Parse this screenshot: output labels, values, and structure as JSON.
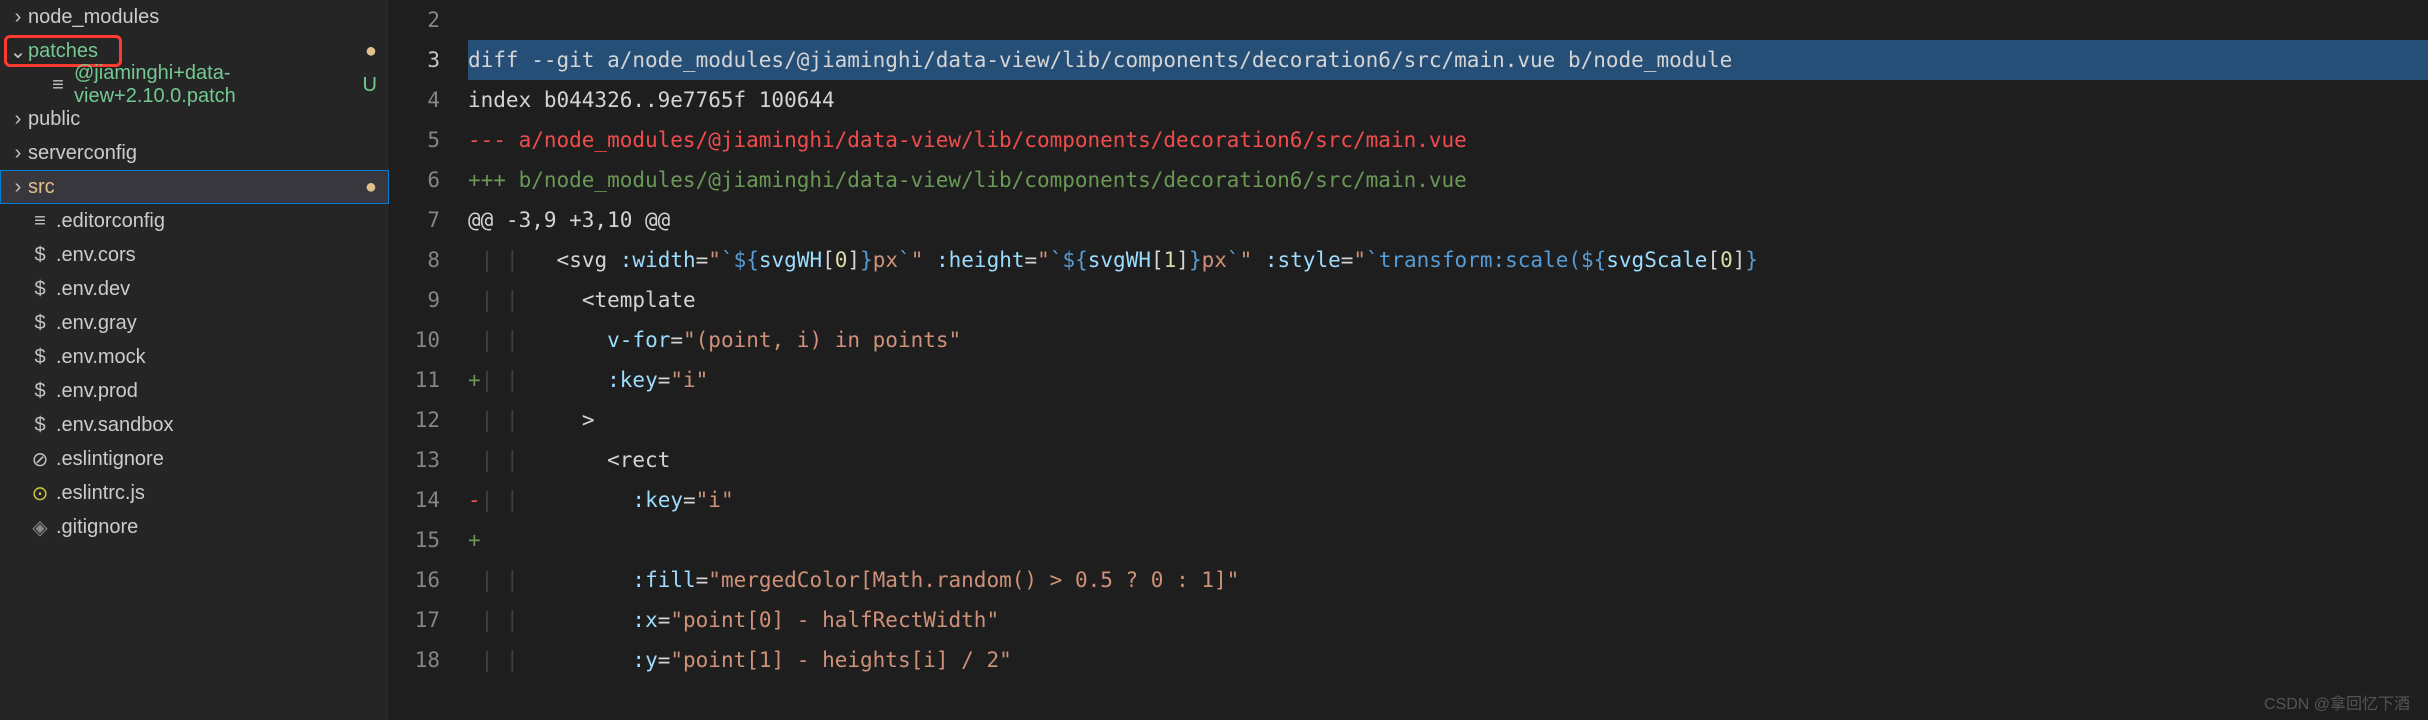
{
  "sidebar": {
    "items": [
      {
        "chevron": "›",
        "icon": "",
        "label": "node_modules",
        "status": "",
        "classes": ""
      },
      {
        "chevron": "⌄",
        "icon": "",
        "label": "patches",
        "status": "●",
        "classes": "added",
        "statusClass": "dot-mod",
        "highlight": true
      },
      {
        "chevron": "",
        "icon": "≡",
        "label": "@jiaminghi+data-view+2.10.0.patch",
        "status": "U",
        "classes": "added",
        "statusClass": "letter-u",
        "indent": 1,
        "iconClass": "icon-diff"
      },
      {
        "chevron": "›",
        "icon": "",
        "label": "public",
        "status": "",
        "classes": ""
      },
      {
        "chevron": "›",
        "icon": "",
        "label": "serverconfig",
        "status": "",
        "classes": ""
      },
      {
        "chevron": "›",
        "icon": "",
        "label": "src",
        "status": "●",
        "classes": "modified",
        "statusClass": "dot-mod",
        "selected": true
      },
      {
        "chevron": "",
        "icon": "≡",
        "label": ".editorconfig",
        "status": "",
        "classes": "",
        "iconClass": "icon-eq"
      },
      {
        "chevron": "",
        "icon": "$",
        "label": ".env.cors",
        "status": "",
        "classes": "",
        "iconClass": "icon-dollar"
      },
      {
        "chevron": "",
        "icon": "$",
        "label": ".env.dev",
        "status": "",
        "classes": "",
        "iconClass": "icon-dollar"
      },
      {
        "chevron": "",
        "icon": "$",
        "label": ".env.gray",
        "status": "",
        "classes": "",
        "iconClass": "icon-dollar"
      },
      {
        "chevron": "",
        "icon": "$",
        "label": ".env.mock",
        "status": "",
        "classes": "",
        "iconClass": "icon-dollar"
      },
      {
        "chevron": "",
        "icon": "$",
        "label": ".env.prod",
        "status": "",
        "classes": "",
        "iconClass": "icon-dollar"
      },
      {
        "chevron": "",
        "icon": "$",
        "label": ".env.sandbox",
        "status": "",
        "classes": "",
        "iconClass": "icon-dollar"
      },
      {
        "chevron": "",
        "icon": "⊘",
        "label": ".eslintignore",
        "status": "",
        "classes": "",
        "iconClass": "icon-sliders"
      },
      {
        "chevron": "",
        "icon": "⊙",
        "label": ".eslintrc.js",
        "status": "",
        "classes": "",
        "iconClass": "icon-js"
      },
      {
        "chevron": "",
        "icon": "◈",
        "label": ".gitignore",
        "status": "",
        "classes": "",
        "iconClass": "icon-diamond"
      }
    ]
  },
  "editor": {
    "lines": [
      {
        "n": 2,
        "current": false,
        "selected": false,
        "seg": [
          [
            "",
            ""
          ]
        ]
      },
      {
        "n": 3,
        "current": true,
        "selected": true,
        "seg": [
          [
            "diff --git a/node_modules/@jiaminghi/data-view/lib/components/decoration6/src/main.vue b/node_module",
            "c-default"
          ]
        ]
      },
      {
        "n": 4,
        "seg": [
          [
            "index b044326..9e7765f 100644",
            "c-default"
          ]
        ]
      },
      {
        "n": 5,
        "seg": [
          [
            "--- a/node_modules/@jiaminghi/data-view/lib/components/decoration6/src/main.vue",
            "c-red"
          ]
        ]
      },
      {
        "n": 6,
        "seg": [
          [
            "+++ b/node_modules/@jiaminghi/data-view/lib/components/decoration6/src/main.vue",
            "c-green"
          ]
        ]
      },
      {
        "n": 7,
        "seg": [
          [
            "@@ -3,9 +3,10 @@",
            "c-default"
          ]
        ]
      },
      {
        "n": 8,
        "seg": [
          [
            " ",
            "c-default"
          ],
          [
            "|",
            "indent-guide"
          ],
          [
            " ",
            "c-default"
          ],
          [
            "|",
            "indent-guide"
          ],
          [
            "   <svg ",
            "c-default"
          ],
          [
            ":width",
            "c-lightblue"
          ],
          [
            "=",
            "c-default"
          ],
          [
            "\"",
            "c-orange"
          ],
          [
            "`${",
            "c-blue"
          ],
          [
            "svgWH",
            "c-lightblue"
          ],
          [
            "[",
            "c-default"
          ],
          [
            "0",
            "c-lightyellow"
          ],
          [
            "]",
            "c-default"
          ],
          [
            "}",
            "c-blue"
          ],
          [
            "px",
            "c-orange"
          ],
          [
            "`",
            "c-blue"
          ],
          [
            "\"",
            "c-orange"
          ],
          [
            " ",
            "c-default"
          ],
          [
            ":height",
            "c-lightblue"
          ],
          [
            "=",
            "c-default"
          ],
          [
            "\"",
            "c-orange"
          ],
          [
            "`${",
            "c-blue"
          ],
          [
            "svgWH",
            "c-lightblue"
          ],
          [
            "[",
            "c-default"
          ],
          [
            "1",
            "c-lightyellow"
          ],
          [
            "]",
            "c-default"
          ],
          [
            "}",
            "c-blue"
          ],
          [
            "px",
            "c-orange"
          ],
          [
            "`",
            "c-blue"
          ],
          [
            "\"",
            "c-orange"
          ],
          [
            " ",
            "c-default"
          ],
          [
            ":style",
            "c-lightblue"
          ],
          [
            "=",
            "c-default"
          ],
          [
            "\"",
            "c-orange"
          ],
          [
            "`transform:scale(${",
            "c-blue"
          ],
          [
            "svgScale",
            "c-lightblue"
          ],
          [
            "[",
            "c-default"
          ],
          [
            "0",
            "c-lightyellow"
          ],
          [
            "]",
            "c-default"
          ],
          [
            "}",
            "c-blue"
          ]
        ]
      },
      {
        "n": 9,
        "seg": [
          [
            " ",
            "c-default"
          ],
          [
            "|",
            "indent-guide"
          ],
          [
            " ",
            "c-default"
          ],
          [
            "|",
            "indent-guide"
          ],
          [
            "     <template",
            "c-default"
          ]
        ]
      },
      {
        "n": 10,
        "seg": [
          [
            " ",
            "c-default"
          ],
          [
            "|",
            "indent-guide"
          ],
          [
            " ",
            "c-default"
          ],
          [
            "|",
            "indent-guide"
          ],
          [
            "       ",
            "c-default"
          ],
          [
            "v-for",
            "c-lightblue"
          ],
          [
            "=",
            "c-default"
          ],
          [
            "\"(point, i) in points\"",
            "c-orange"
          ]
        ]
      },
      {
        "n": 11,
        "seg": [
          [
            "+",
            "c-green"
          ],
          [
            "|",
            "indent-guide"
          ],
          [
            " ",
            "c-default"
          ],
          [
            "|",
            "indent-guide"
          ],
          [
            "       ",
            "c-default"
          ],
          [
            ":key",
            "c-lightblue"
          ],
          [
            "=",
            "c-default"
          ],
          [
            "\"i\"",
            "c-orange"
          ]
        ]
      },
      {
        "n": 12,
        "seg": [
          [
            " ",
            "c-default"
          ],
          [
            "|",
            "indent-guide"
          ],
          [
            " ",
            "c-default"
          ],
          [
            "|",
            "indent-guide"
          ],
          [
            "     >",
            "c-default"
          ]
        ]
      },
      {
        "n": 13,
        "seg": [
          [
            " ",
            "c-default"
          ],
          [
            "|",
            "indent-guide"
          ],
          [
            " ",
            "c-default"
          ],
          [
            "|",
            "indent-guide"
          ],
          [
            "       <rect",
            "c-default"
          ]
        ]
      },
      {
        "n": 14,
        "seg": [
          [
            "-",
            "c-red"
          ],
          [
            "|",
            "indent-guide"
          ],
          [
            " ",
            "c-default"
          ],
          [
            "|",
            "indent-guide"
          ],
          [
            "         ",
            "c-default"
          ],
          [
            ":key",
            "c-lightblue"
          ],
          [
            "=",
            "c-default"
          ],
          [
            "\"i\"",
            "c-orange"
          ]
        ]
      },
      {
        "n": 15,
        "seg": [
          [
            "+",
            "c-green"
          ]
        ]
      },
      {
        "n": 16,
        "seg": [
          [
            " ",
            "c-default"
          ],
          [
            "|",
            "indent-guide"
          ],
          [
            " ",
            "c-default"
          ],
          [
            "|",
            "indent-guide"
          ],
          [
            "         ",
            "c-default"
          ],
          [
            ":fill",
            "c-lightblue"
          ],
          [
            "=",
            "c-default"
          ],
          [
            "\"mergedColor[Math.random() > 0.5 ? 0 : 1]\"",
            "c-orange"
          ]
        ]
      },
      {
        "n": 17,
        "seg": [
          [
            " ",
            "c-default"
          ],
          [
            "|",
            "indent-guide"
          ],
          [
            " ",
            "c-default"
          ],
          [
            "|",
            "indent-guide"
          ],
          [
            "         ",
            "c-default"
          ],
          [
            ":x",
            "c-lightblue"
          ],
          [
            "=",
            "c-default"
          ],
          [
            "\"point[0] - halfRectWidth\"",
            "c-orange"
          ]
        ]
      },
      {
        "n": 18,
        "seg": [
          [
            " ",
            "c-default"
          ],
          [
            "|",
            "indent-guide"
          ],
          [
            " ",
            "c-default"
          ],
          [
            "|",
            "indent-guide"
          ],
          [
            "         ",
            "c-default"
          ],
          [
            ":y",
            "c-lightblue"
          ],
          [
            "=",
            "c-default"
          ],
          [
            "\"point[1] - heights[i] / 2\"",
            "c-orange"
          ]
        ]
      }
    ]
  },
  "watermark": "CSDN @拿回忆下酒"
}
